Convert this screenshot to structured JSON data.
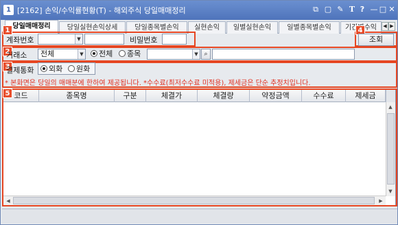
{
  "window": {
    "id_badge": "1",
    "title": "[2162] 손익/수익률현황(T) - 해외주식 당일매매정리",
    "controls": [
      "⧉",
      "▢",
      "✎",
      "T",
      "?",
      "—",
      "□",
      "✕"
    ]
  },
  "tabs": [
    {
      "label": "당일매매정리",
      "active": true
    },
    {
      "label": "당일실현손익상세",
      "active": false
    },
    {
      "label": "당일종목별손익",
      "active": false
    },
    {
      "label": "실현손익",
      "active": false
    },
    {
      "label": "일별실현손익",
      "active": false
    },
    {
      "label": "일별종목별손익",
      "active": false
    },
    {
      "label": "기간별수익",
      "active": false
    }
  ],
  "tab_nav": {
    "prev": "◀",
    "next": "▶"
  },
  "row1": {
    "badge": "1",
    "account_label": "계좌번호",
    "account_value": "",
    "account_name": "",
    "password_label": "비밀번호",
    "password_value": ""
  },
  "search": {
    "badge": "4",
    "label": "조회"
  },
  "row2": {
    "badge": "2",
    "exchange_label": "거래소",
    "exchange_value": "전체",
    "radio_all": "전체",
    "radio_item": "종목",
    "item_code": "",
    "item_name": ""
  },
  "row3": {
    "badge": "3",
    "currency_label": "결제통화",
    "radio_foreign": "외화",
    "radio_won": "원화"
  },
  "notice": "* 본화면은 당일의 매매분에 한하여 제공됩니다.  *수수료(최저수수료 미적용), 제세금은 단순 추정치입니다.",
  "grid": {
    "badge": "5",
    "columns": [
      "코드",
      "종목명",
      "구분",
      "체결가",
      "체결량",
      "약정금액",
      "수수료",
      "제세금"
    ],
    "rows": []
  },
  "colors": {
    "accent": "#e64622",
    "titlebar": "#5a7fc4"
  }
}
